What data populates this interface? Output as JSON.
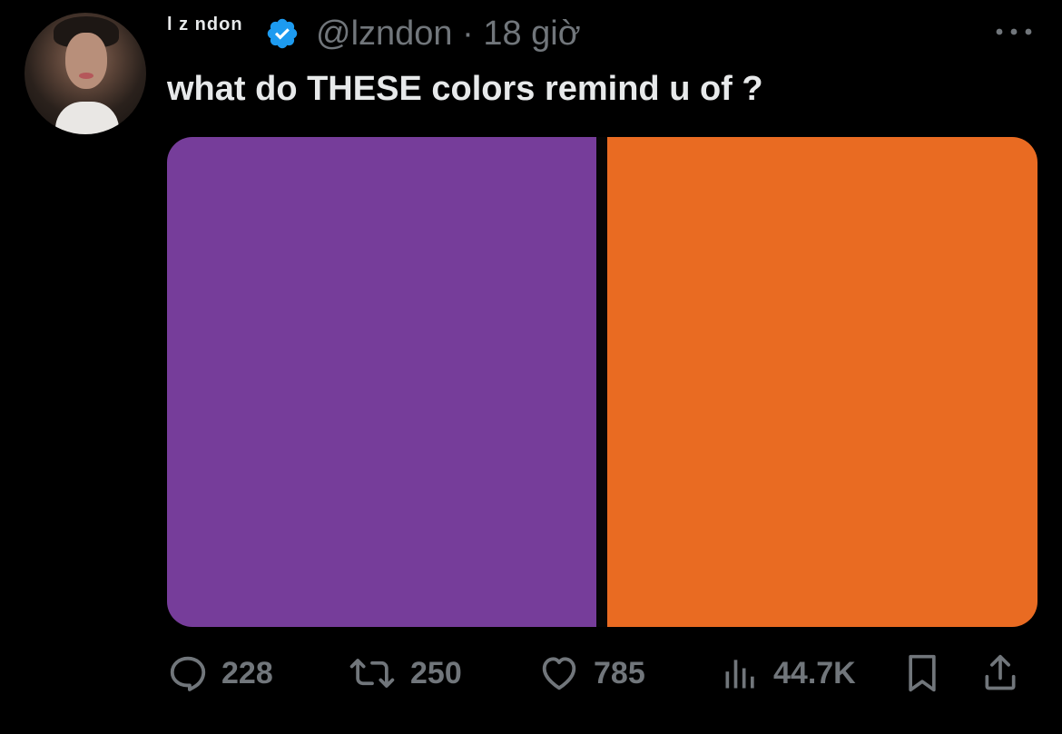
{
  "tweet": {
    "author": {
      "display_name": "l z ndon",
      "handle_time": "@lzndon · 18 giờ",
      "verified": true,
      "avatar_icon": "profile-photo"
    },
    "text": "what do THESE colors remind u of ?",
    "media": {
      "swatches": [
        {
          "name": "purple",
          "color": "#763d9a"
        },
        {
          "name": "orange",
          "color": "#e96b22"
        }
      ]
    },
    "actions": {
      "replies": "228",
      "retweets": "250",
      "likes": "785",
      "views": "44.7K"
    }
  },
  "colors": {
    "background": "#000000",
    "text_primary": "#e7e9ea",
    "text_secondary": "#71767b",
    "verified_blue": "#1d9bf0"
  }
}
